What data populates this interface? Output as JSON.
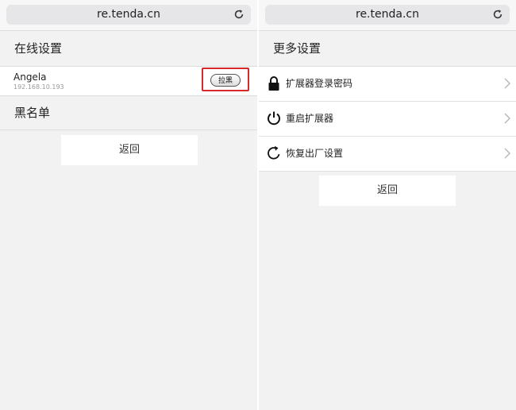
{
  "left": {
    "url": "re.tenda.cn",
    "online_title": "在线设置",
    "device": {
      "name": "Angela",
      "ip": "192.168.10.193",
      "block_label": "拉黑"
    },
    "blacklist_title": "黑名单",
    "back_label": "返回"
  },
  "right": {
    "url": "re.tenda.cn",
    "more_title": "更多设置",
    "menu": [
      {
        "label": "扩展器登录密码",
        "icon": "lock-icon"
      },
      {
        "label": "重启扩展器",
        "icon": "power-icon"
      },
      {
        "label": "恢复出厂设置",
        "icon": "reset-icon"
      }
    ],
    "back_label": "返回"
  },
  "colors": {
    "highlight": "#d42a2a",
    "background": "#f2f2f2"
  }
}
